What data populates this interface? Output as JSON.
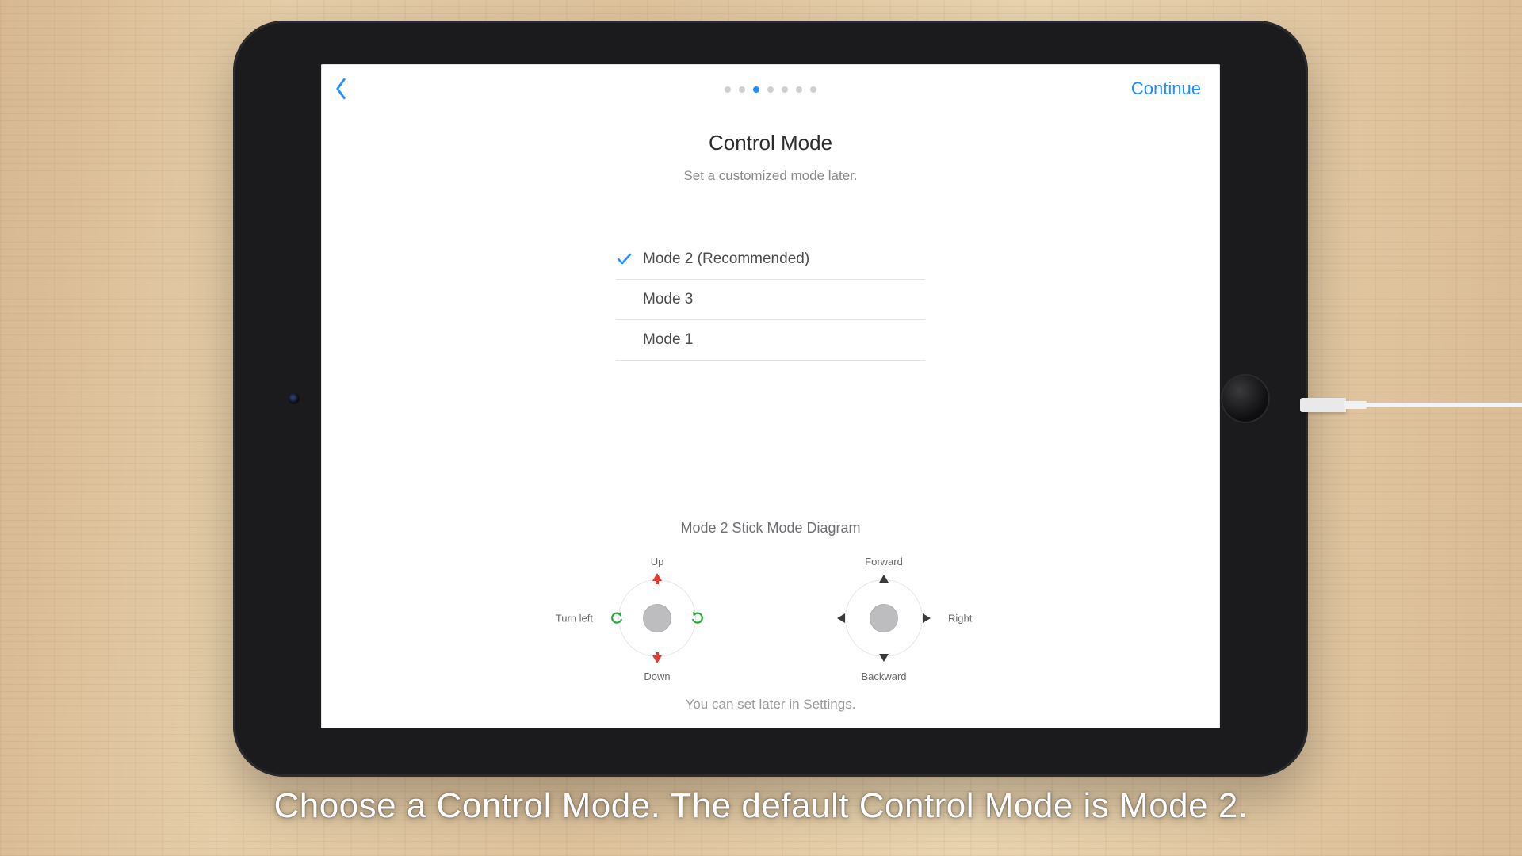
{
  "nav": {
    "continue_label": "Continue",
    "page_dots": {
      "count": 7,
      "active_index": 2
    }
  },
  "header": {
    "title": "Control Mode",
    "subtitle": "Set a customized mode later."
  },
  "modes": [
    {
      "label": "Mode 2 (Recommended)",
      "selected": true
    },
    {
      "label": "Mode 3",
      "selected": false
    },
    {
      "label": "Mode 1",
      "selected": false
    }
  ],
  "diagram": {
    "title": "Mode 2 Stick Mode Diagram",
    "left_stick": {
      "up": "Up",
      "down": "Down",
      "left": "Turn left",
      "right": ""
    },
    "right_stick": {
      "up": "Forward",
      "down": "Backward",
      "left": "",
      "right": "Right"
    },
    "footer": "You can set later in Settings."
  },
  "caption": "Choose a Control Mode. The default Control Mode is Mode 2."
}
